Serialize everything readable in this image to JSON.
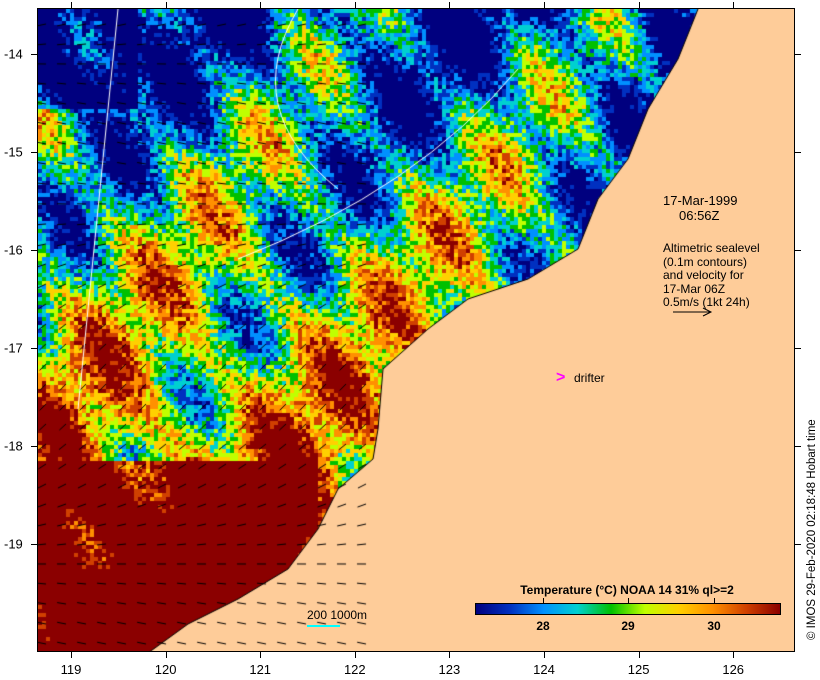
{
  "axes": {
    "lon_ticks": [
      "119",
      "120",
      "121",
      "122",
      "123",
      "124",
      "125",
      "126"
    ],
    "lat_ticks": [
      "-14",
      "-15",
      "-16",
      "-17",
      "-18",
      "-19"
    ]
  },
  "annotation": {
    "date": "17-Mar-1999",
    "time": "06:56Z",
    "lines": [
      "Altimetric sealevel",
      "(0.1m contours)",
      "and velocity for",
      "17-Mar 06Z",
      "0.5m/s (1kt 24h)"
    ]
  },
  "drifter": {
    "symbol": ">",
    "label": "drifter",
    "color": "#ff00ff"
  },
  "depth_legend": {
    "label": "200  1000m",
    "color": "#00ffff"
  },
  "colorbar": {
    "title": "Temperature (°C) NOAA 14 31% ql>=2",
    "ticks": [
      "28",
      "29",
      "30"
    ],
    "range": [
      27.1,
      30.8
    ]
  },
  "credit": "© IMOS 29-Feb-2020 02:18:48 Hobart time",
  "colors": {
    "land": "#fecc99"
  }
}
